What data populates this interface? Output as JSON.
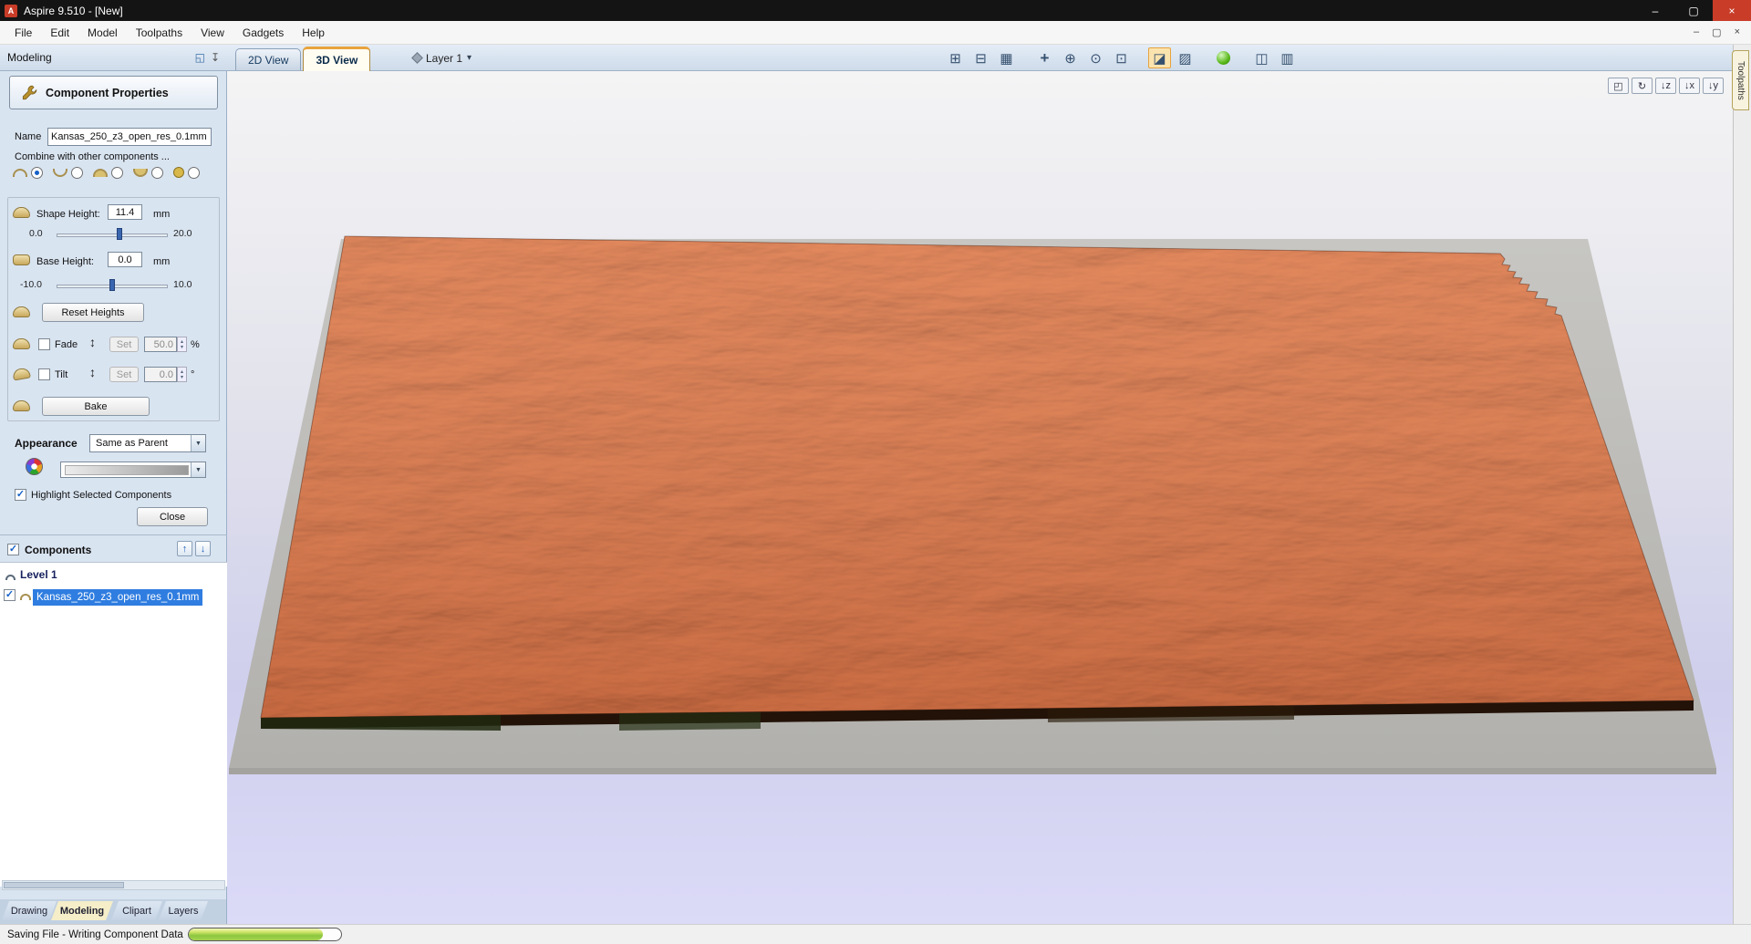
{
  "colors": {
    "titlebar": "#141414",
    "menubar": "#f6f6f6",
    "panel_bg": "#d9e4f1",
    "toolstrip_top": "#e4edf7",
    "toolstrip_bottom": "#cedbea",
    "tab_active": "#f5eec9",
    "selection": "#2f7de0",
    "accent_orange": "#e8a33d",
    "terrain": "#c86f47",
    "terrain_shadow": "#231208",
    "slab": "#bcbbb7",
    "bg_top": "#f4f4f5",
    "bg_bottom": "#dbdaf7",
    "progress_green": "#8cc63f",
    "close_red": "#c83c28"
  },
  "icons": {
    "app": "A",
    "minimize": "–",
    "restore": "▢",
    "close": "×",
    "mdi_minimize": "–",
    "mdi_restore": "▢",
    "mdi_close": "×",
    "dock": "◱",
    "pin": "↧",
    "caret_down": "▾",
    "caret_small": "▼",
    "fit_drawing": "⊞",
    "fit_material": "⊟",
    "grid": "▦",
    "pan": "+",
    "zoom_dynamic": "⊕",
    "zoom_extents": "⊙",
    "zoom_box": "⊡",
    "shaded_toggle": "◪",
    "draw_toolpath": "▨",
    "pane_single": "◫",
    "pane_multi": "▥",
    "view_iso": "◰",
    "view_rotate": "↻",
    "view_down_z": "↓z",
    "view_down_x": "↓x",
    "view_down_y": "↓y",
    "updown_arrow": "↕",
    "up_arrow": "↑",
    "down_arrow": "↓",
    "check": "✓",
    "spin_up": "▴",
    "spin_down": "▾"
  },
  "titlebar": {
    "title": "Aspire 9.510 - [New]"
  },
  "menu": {
    "items": [
      "File",
      "Edit",
      "Model",
      "Toolpaths",
      "View",
      "Gadgets",
      "Help"
    ]
  },
  "toolstrip": {
    "panel_caption": "Modeling",
    "tabs": [
      "2D View",
      "3D View"
    ],
    "active_tab": "3D View",
    "layer_label": "Layer 1"
  },
  "panel": {
    "header": "Component Properties",
    "name_label": "Name",
    "name_value": "Kansas_250_z3_open_res_0.1mm",
    "combine_label": "Combine with other components ...",
    "shape_height": {
      "label": "Shape Height:",
      "value": "11.4",
      "unit": "mm",
      "min": "0.0",
      "max": "20.0"
    },
    "base_height": {
      "label": "Base Height:",
      "value": "0.0",
      "unit": "mm",
      "min": "-10.0",
      "max": "10.0"
    },
    "reset_label": "Reset Heights",
    "fade": {
      "label": "Fade",
      "set": "Set",
      "value": "50.0",
      "unit": "%"
    },
    "tilt": {
      "label": "Tilt",
      "set": "Set",
      "value": "0.0",
      "unit": "°"
    },
    "bake_label": "Bake",
    "appearance_label": "Appearance",
    "appearance_value": "Same as Parent",
    "highlight_label": "Highlight Selected Components",
    "close_label": "Close"
  },
  "components": {
    "header": "Components",
    "level": "Level 1",
    "item": "Kansas_250_z3_open_res_0.1mm"
  },
  "sidebar_tabs": [
    "Drawing",
    "Modeling",
    "Clipart",
    "Layers"
  ],
  "right_tab": "Toolpaths",
  "status": {
    "text": "Saving File - Writing Component Data",
    "progress_pct": 88
  }
}
